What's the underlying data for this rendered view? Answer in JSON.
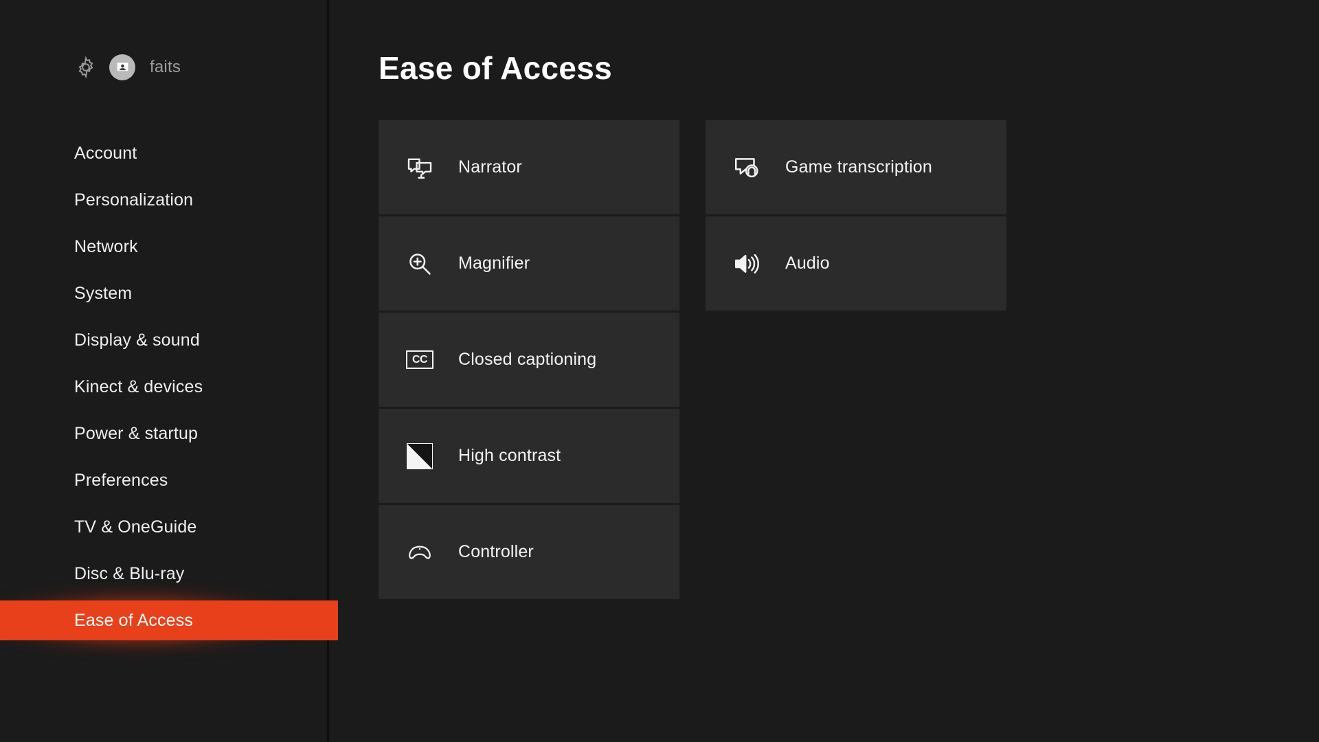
{
  "theme": {
    "app_background": "#1b1b1b",
    "tile_background": "#2b2b2b",
    "accent_highlight": "#e8401a",
    "text_primary": "#f4f4f4",
    "text_muted": "#9e9e9e"
  },
  "sidebar": {
    "settings_icon": "gear-icon",
    "avatar_icon": "user-avatar-icon",
    "profile_name": "faits",
    "items": [
      {
        "label": "Account",
        "selected": false
      },
      {
        "label": "Personalization",
        "selected": false
      },
      {
        "label": "Network",
        "selected": false
      },
      {
        "label": "System",
        "selected": false
      },
      {
        "label": "Display & sound",
        "selected": false
      },
      {
        "label": "Kinect & devices",
        "selected": false
      },
      {
        "label": "Power & startup",
        "selected": false
      },
      {
        "label": "Preferences",
        "selected": false
      },
      {
        "label": "TV & OneGuide",
        "selected": false
      },
      {
        "label": "Disc & Blu-ray",
        "selected": false
      },
      {
        "label": "Ease of Access",
        "selected": true
      }
    ]
  },
  "main": {
    "title": "Ease of Access",
    "columns": [
      {
        "tiles": [
          {
            "label": "Narrator",
            "icon": "narrator-screen-speech-icon"
          },
          {
            "label": "Magnifier",
            "icon": "magnifier-plus-icon"
          },
          {
            "label": "Closed captioning",
            "icon": "closed-captioning-cc-icon"
          },
          {
            "label": "High contrast",
            "icon": "high-contrast-split-square-icon"
          },
          {
            "label": "Controller",
            "icon": "game-controller-icon"
          }
        ]
      },
      {
        "tiles": [
          {
            "label": "Game transcription",
            "icon": "speech-bubble-headset-icon"
          },
          {
            "label": "Audio",
            "icon": "speaker-volume-icon"
          }
        ]
      }
    ]
  }
}
